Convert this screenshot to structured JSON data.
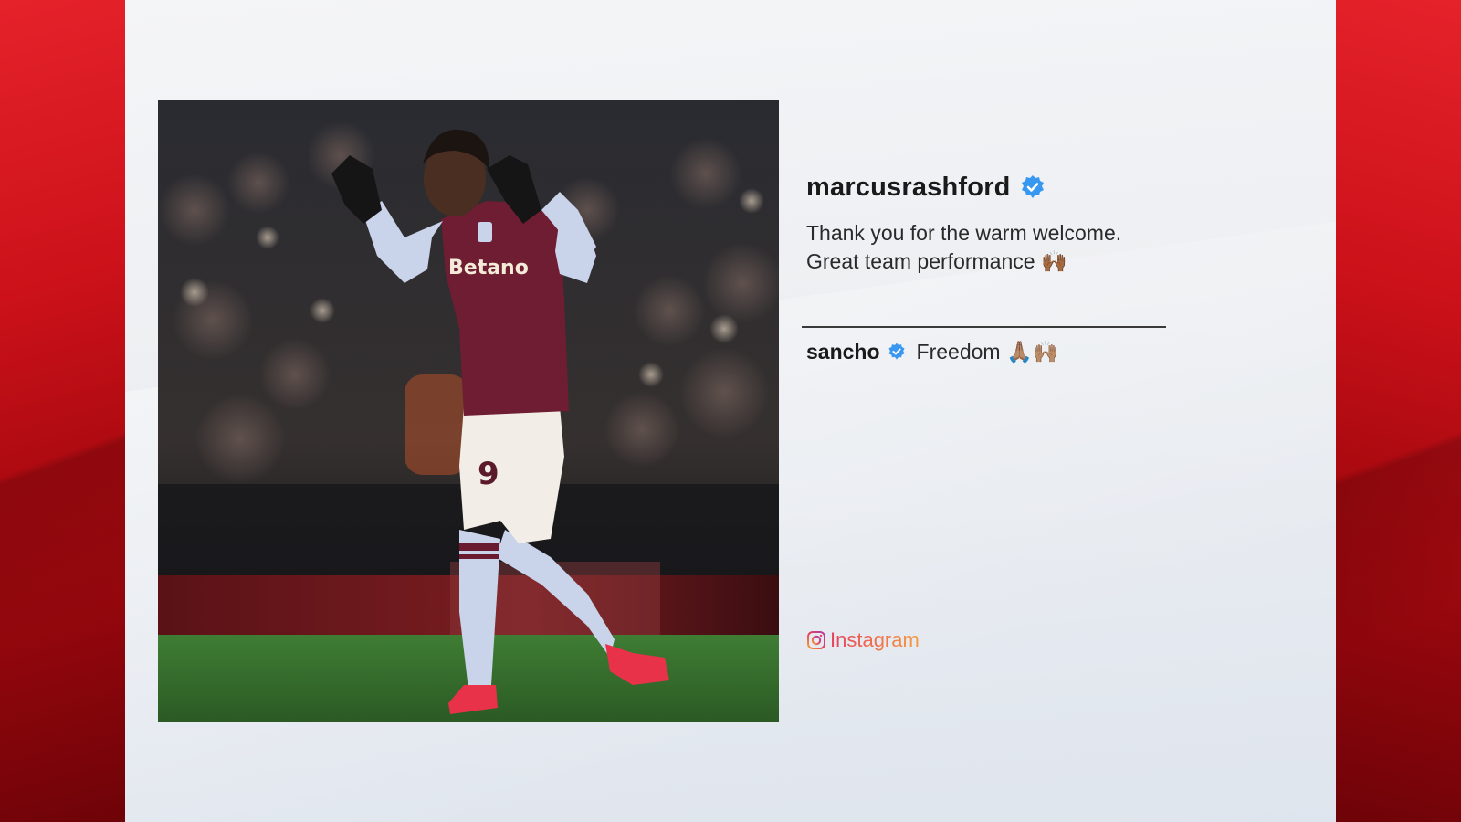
{
  "post": {
    "username": "marcusrashford",
    "caption_line1": "Thank you for the warm welcome.",
    "caption_line2": "Great team performance 🙌🏾"
  },
  "comment": {
    "username": "sancho",
    "text": "Freedom 🙏🏽🙌🏽"
  },
  "platform": {
    "name": "Instagram"
  },
  "photo": {
    "subject": "footballer in claret and blue kit, number 9, applauding",
    "shirt_sponsor": "Betano",
    "shirt_number": "9"
  },
  "colors": {
    "frame_red": "#d6111a",
    "panel": "#eef0f3",
    "verified_blue": "#3897f0",
    "instagram": "#e5405e"
  },
  "icons": {
    "verified": "verified-badge-icon",
    "instagram": "instagram-icon"
  }
}
